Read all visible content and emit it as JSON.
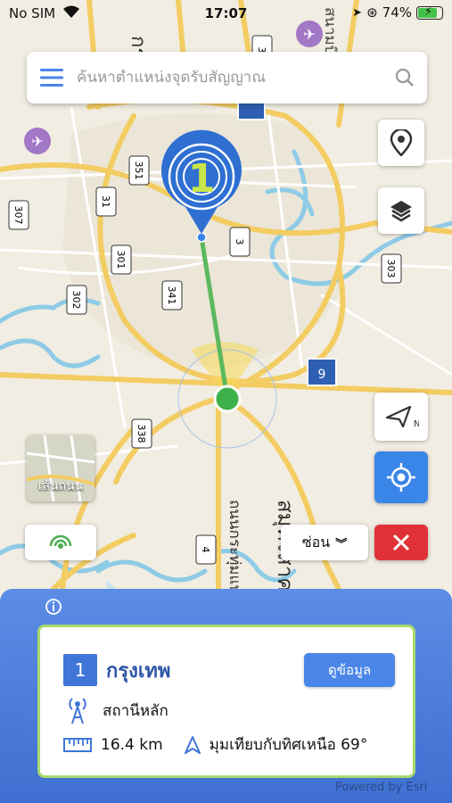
{
  "status_bar": {
    "carrier": "No SIM",
    "time": "17:07",
    "battery": "74%"
  },
  "search": {
    "placeholder": "ค้นหาตำแหน่งจุดรับสัญญาณ"
  },
  "map": {
    "station_number": "1",
    "road_shields": [
      "3",
      "351",
      "31",
      "307",
      "301",
      "302",
      "341",
      "3",
      "303",
      "9",
      "338",
      "4"
    ],
    "place_labels": [
      "กรุงเท",
      "สนามบิน",
      "ถนนกระทุ่มแบน",
      "สมุทรสาคร"
    ],
    "thumbnail_label": "เส้นถนน"
  },
  "controls": {
    "hide_label": "ซ่อน"
  },
  "panel": {
    "card": {
      "number": "1",
      "name": "กรุงเทพ",
      "detail_button": "ดูข้อมูล",
      "station_type": "สถานีหลัก",
      "distance": "16.4 km",
      "bearing": "มุมเทียบกับทิศเหนือ 69°"
    },
    "powered_by": "Powered by Esri"
  },
  "colors": {
    "accent": "#3f76d8",
    "route": "#5cb85c",
    "close": "#e03236",
    "card_border": "#a8d96f"
  }
}
